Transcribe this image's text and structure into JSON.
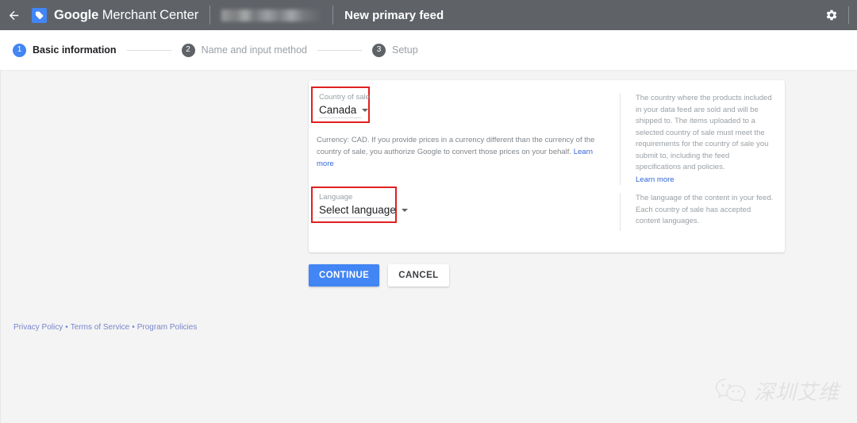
{
  "appbar": {
    "back_icon": "back-arrow-icon",
    "logo_icon": "google-merchant-center-logo-icon",
    "brand_bold": "Google",
    "brand_light": " Merchant Center",
    "account_name": "",
    "page_title": "New primary feed",
    "gear_icon": "gear-icon"
  },
  "stepper": {
    "steps": [
      {
        "number": "1",
        "label": "Basic information",
        "state": "active"
      },
      {
        "number": "2",
        "label": "Name and input method",
        "state": "inactive"
      },
      {
        "number": "3",
        "label": "Setup",
        "state": "inactive"
      }
    ]
  },
  "form": {
    "country": {
      "label": "Country of sale",
      "value": "Canada",
      "highlighted": true,
      "highlight_color": "#e02020"
    },
    "currency_note": {
      "text": "Currency: CAD. If you provide prices in a currency different than the currency of the country of sale, you authorize Google to convert those prices on your behalf. ",
      "link": "Learn more"
    },
    "language": {
      "label": "Language",
      "value": "Select language",
      "highlighted": true,
      "highlight_color": "#e02020"
    }
  },
  "help": {
    "country": {
      "text": "The country where the products included in your data feed are sold and will be shipped to. The items uploaded to a selected country of sale must meet the requirements for the country of sale you submit to, including the feed specifications and policies.",
      "link": "Learn more"
    },
    "language": {
      "text": "The language of the content in your feed. Each country of sale has accepted content languages."
    }
  },
  "actions": {
    "continue_label": "CONTINUE",
    "cancel_label": "CANCEL",
    "primary_color": "#4285f4"
  },
  "footer": {
    "privacy": "Privacy Policy",
    "terms": "Terms of Service",
    "program": "Program Policies",
    "separator": "•"
  },
  "watermark": {
    "icon": "wechat-icon",
    "text": "深圳艾维"
  }
}
